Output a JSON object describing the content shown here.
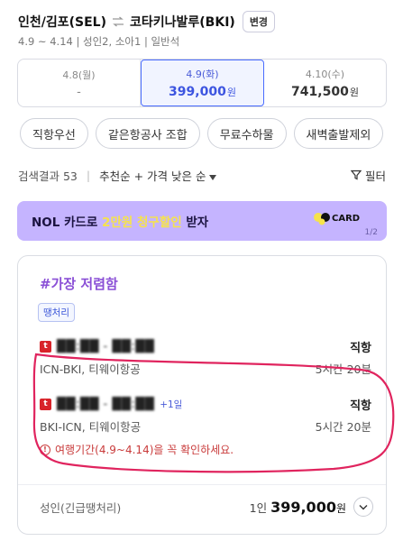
{
  "header": {
    "origin": "인천/김포(SEL)",
    "destination": "코타키나발루(BKI)",
    "change_label": "변경",
    "meta": "4.9 ~ 4.14 | 성인2, 소아1 | 일반석"
  },
  "dates": [
    {
      "label": "4.8(월)",
      "price": "-",
      "unit": ""
    },
    {
      "label": "4.9(화)",
      "price": "399,000",
      "unit": "원",
      "selected": true
    },
    {
      "label": "4.10(수)",
      "price": "741,500",
      "unit": "원"
    }
  ],
  "filters": [
    "직항우선",
    "같은항공사 조합",
    "무료수하물",
    "새벽출발제외"
  ],
  "sort": {
    "results_label": "검색결과 53",
    "option": "추천순 + 가격 낮은 순",
    "filter_label": "필터"
  },
  "banner": {
    "text_before": "NOL 카드로 ",
    "highlight": "2만원 청구할인",
    "text_after": " 받자",
    "logo_text": "CARD",
    "page": "1/2"
  },
  "result": {
    "badge": "#가장 저렴함",
    "tag": "땡처리",
    "flights": [
      {
        "times": "██:██ - ██:██",
        "plus_day": "",
        "type": "직항",
        "route": "ICN-BKI, 티웨이항공",
        "duration": "5시간 20분"
      },
      {
        "times": "██:██ - ██:██",
        "plus_day": "+1일",
        "type": "직항",
        "route": "BKI-ICN, 티웨이항공",
        "duration": "5시간 20분"
      }
    ],
    "notice": "여행기간(4.9~4.14)을 꼭 확인하세요.",
    "fare_type": "성인(긴급땡처리)",
    "fare_unit": "1인",
    "fare_price": "399,000",
    "fare_won": "원"
  },
  "colors": {
    "accent": "#3d55e0",
    "purple": "#8a4fd6",
    "banner_bg": "#c5b4ff",
    "banner_highlight": "#f6e34b",
    "warning": "#c93b3b",
    "annotation": "#e0245e"
  }
}
